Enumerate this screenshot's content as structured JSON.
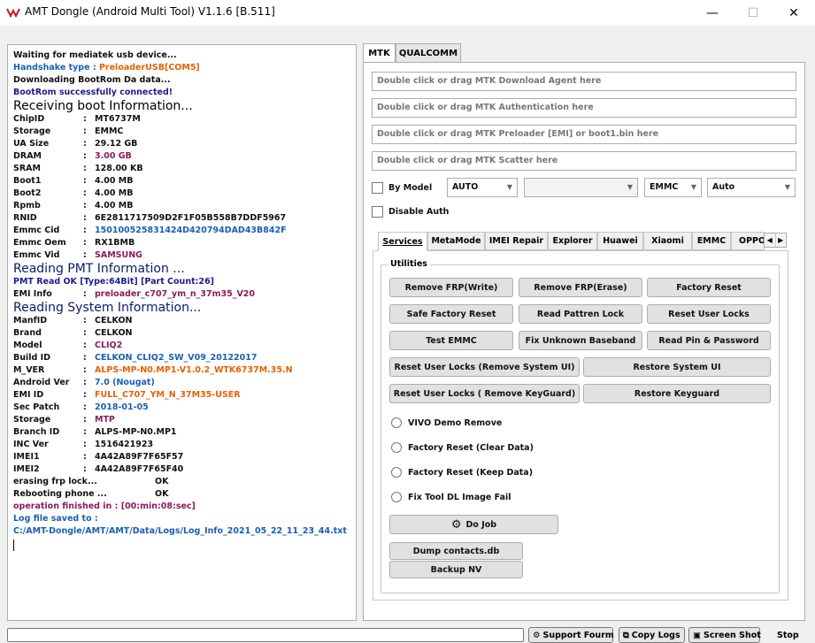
{
  "window": {
    "title": "AMT Dongle (Android Multi Tool) V1.1.6 [B.511]",
    "minimize": "—",
    "maximize": "☐",
    "close": "✕"
  },
  "log": {
    "lines": [
      {
        "text": "Waiting for mediatek usb device...",
        "color": "#111111"
      },
      {
        "text": "Handshake type : ",
        "color": "#1a5fb4",
        "extra": "PreloaderUSB[COM5]",
        "extra_color": "#e66100"
      },
      {
        "text": "Downloading BootRom Da data...",
        "color": "#111111"
      },
      {
        "text": "BootRom successfully connected!",
        "color": "#1c1c8c"
      }
    ],
    "headings": {
      "boot": "Receiving boot Information...",
      "pmt": "Reading PMT Information ...",
      "system": "Reading System Information..."
    },
    "boot_info": [
      {
        "k": "ChipID",
        "v": "MT6737M",
        "color": "#111111"
      },
      {
        "k": "Storage",
        "v": "EMMC",
        "color": "#111111"
      },
      {
        "k": "UA Size",
        "v": "29.12 GB",
        "color": "#111111"
      },
      {
        "k": "DRAM",
        "v": "3.00 GB",
        "color": "#8b1a5c"
      },
      {
        "k": "SRAM",
        "v": "128.00 KB",
        "color": "#111111"
      },
      {
        "k": "Boot1",
        "v": "4.00 MB",
        "color": "#111111"
      },
      {
        "k": "Boot2",
        "v": "4.00 MB",
        "color": "#111111"
      },
      {
        "k": "Rpmb",
        "v": "4.00 MB",
        "color": "#111111"
      },
      {
        "k": "RNID",
        "v": "6E2811717509D2F1F05B558B7DDF5967",
        "color": "#111111"
      },
      {
        "k": "Emmc Cid",
        "v": "150100525831424D420794DAD43B842F",
        "color": "#1a5fb4"
      },
      {
        "k": "Emmc Oem",
        "v": "RX1BMB",
        "color": "#111111"
      },
      {
        "k": "Emmc Vid",
        "v": "SAMSUNG",
        "color": "#8b1a5c"
      }
    ],
    "pmt_line": "PMT Read OK [Type:64Bit] [Part Count:26]",
    "emi": {
      "k": "EMI Info",
      "v": "preloader_c707_ym_n_37m35_V20",
      "color": "#8b1a5c"
    },
    "system_info": [
      {
        "k": "ManfID",
        "v": "CELKON",
        "color": "#111111"
      },
      {
        "k": "Brand",
        "v": "CELKON",
        "color": "#111111"
      },
      {
        "k": "Model",
        "v": "CLIQ2",
        "color": "#8b1a5c"
      },
      {
        "k": "Build ID",
        "v": "CELKON_CLIQ2_SW_V09_20122017",
        "color": "#1a5fb4"
      },
      {
        "k": "M_VER",
        "v": "ALPS-MP-N0.MP1-V1.0.2_WTK6737M.35.N",
        "color": "#e66100"
      },
      {
        "k": "Android Ver",
        "v": "7.0 (Nougat)",
        "color": "#1a5fb4"
      },
      {
        "k": "EMI ID",
        "v": "FULL_C707_YM_N_37M35-USER",
        "color": "#e66100"
      },
      {
        "k": "Sec Patch",
        "v": "2018-01-05",
        "color": "#1a5fb4"
      },
      {
        "k": "Storage",
        "v": "MTP",
        "color": "#8b1a5c"
      },
      {
        "k": "Branch ID",
        "v": "ALPS-MP-N0.MP1",
        "color": "#111111"
      },
      {
        "k": "INC Ver",
        "v": "1516421923",
        "color": "#111111"
      },
      {
        "k": "IMEI1",
        "v": "4A42A89F7F65F57",
        "color": "#111111"
      },
      {
        "k": "IMEI2",
        "v": "4A42A89F7F65F40",
        "color": "#111111"
      }
    ],
    "status": [
      {
        "k": "erasing frp lock...",
        "v": "OK"
      },
      {
        "k": "Rebooting phone ...",
        "v": "OK"
      }
    ],
    "finished": "operation finished in : [00:min:08:sec]",
    "saved_label": "Log file saved to :",
    "saved_path": "C:/AMT-Dongle/AMT/AMT/Data/Logs/Log_Info_2021_05_22_11_23_44.txt"
  },
  "tabs": [
    "MTK",
    "QUALCOMM"
  ],
  "drops": [
    "Double click or drag MTK Download Agent here",
    "Double click or drag MTK Authentication here",
    "Double click or drag MTK Preloader [EMI] or boot1.bin here",
    "Double click or drag MTK Scatter here"
  ],
  "options": {
    "by_model": "By Model",
    "model_combo": "AUTO",
    "blank_combo": "",
    "storage_combo": "EMMC",
    "mode_combo": "Auto",
    "disable_auth": "Disable Auth"
  },
  "subtabs": [
    "Services",
    "MetaMode",
    "IMEI Repair",
    "Explorer",
    "Huawei",
    "Xiaomi",
    "EMMC",
    "OPPO"
  ],
  "utilities": {
    "title": "Utilities",
    "buttons": [
      "Remove FRP(Write)",
      "Remove FRP(Erase)",
      "Factory Reset",
      "Safe Factory Reset",
      "Read Pattren Lock",
      "Reset User Locks",
      "Test EMMC",
      "Fix Unknown Baseband",
      "Read Pin & Password",
      "Reset User Locks (Remove System UI)",
      "Restore System UI",
      "Reset User Locks ( Remove KeyGuard)",
      "Restore Keyguard"
    ],
    "radios": [
      "VIVO Demo Remove",
      "Factory Reset (Clear Data)",
      "Factory Reset (Keep Data)",
      "Fix Tool DL Image Fail"
    ],
    "do_job": "Do Job",
    "dump_contacts": "Dump contacts.db",
    "backup_nv": "Backup NV"
  },
  "bottom": {
    "support": "Support Fourm",
    "copy_logs": "Copy Logs",
    "screen_shot": "Screen Shot",
    "stop": "Stop"
  }
}
